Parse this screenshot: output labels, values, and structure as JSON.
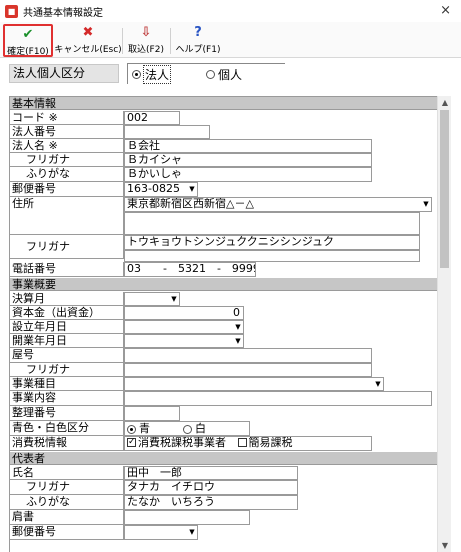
{
  "window": {
    "title": "共通基本情報設定",
    "close_glyph": "×"
  },
  "toolbar": {
    "confirm": {
      "icon": "✔",
      "label": "確定(F10)",
      "color": "#1a8f2a"
    },
    "cancel": {
      "icon": "✖",
      "label": "キャンセル(Esc)",
      "color": "#d42a2a"
    },
    "import": {
      "icon": "⇩",
      "label": "取込(F2)",
      "color": "#c04040"
    },
    "help": {
      "icon": "?",
      "label": "ヘルプ(F1)",
      "color": "#2a55c4"
    }
  },
  "corp_type": {
    "label": "法人個人区分",
    "options": [
      "法人",
      "個人"
    ],
    "selected": "法人"
  },
  "sections": {
    "basic": "基本情報",
    "business": "事業概要",
    "representative": "代表者"
  },
  "basic": {
    "code_label": "コード ※",
    "code_value": "002",
    "corp_no_label": "法人番号",
    "corp_no_value": "",
    "name_label": "法人名 ※",
    "name_value": "Ｂ会社",
    "furigana_label": "フリガナ",
    "furigana_value": "Ｂカイシャ",
    "hiragana_label": "ふりがな",
    "hiragana_value": "Ｂかいしゃ",
    "postal_label": "郵便番号",
    "postal_value": "163-0825",
    "address_label": "住所",
    "address_value": "東京都新宿区西新宿△－△",
    "address_furigana_label": "フリガナ",
    "address_furigana_value": "トウキョウトシンジュククニシシンジュク",
    "phone_label": "電話番号",
    "phone_value": "03　　-　5321　-　9999"
  },
  "business": {
    "fiscal_month_label": "決算月",
    "fiscal_month_value": "",
    "capital_label": "資本金（出資金）",
    "capital_value": "0",
    "founded_label": "設立年月日",
    "founded_value": "",
    "opened_label": "開業年月日",
    "opened_value": "",
    "trade_name_label": "屋号",
    "trade_name_value": "",
    "trade_furigana_label": "フリガナ",
    "trade_furigana_value": "",
    "industry_label": "事業種目",
    "industry_value": "",
    "content_label": "事業内容",
    "content_value": "",
    "ref_no_label": "整理番号",
    "ref_no_value": "",
    "color_label": "青色・白色区分",
    "color_options": [
      "青",
      "白"
    ],
    "color_selected": "青",
    "tax_label": "消費税情報",
    "tax_option1": "消費税課税事業者",
    "tax_option2": "簡易課税"
  },
  "representative": {
    "name_label": "氏名",
    "name_value": "田中　一郎",
    "furigana_label": "フリガナ",
    "furigana_value": "タナカ　イチロウ",
    "hiragana_label": "ふりがな",
    "hiragana_value": "たなか　いちろう",
    "title_label": "肩書",
    "title_value": "",
    "postal_label": "郵便番号"
  }
}
